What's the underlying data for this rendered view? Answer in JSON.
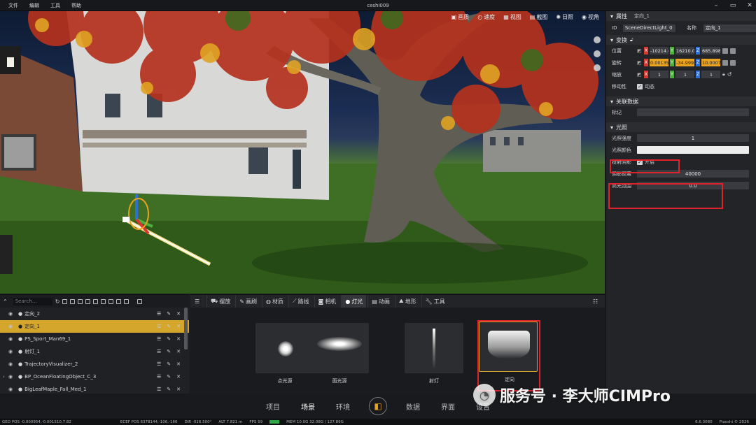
{
  "window": {
    "menu": [
      "文件",
      "编辑",
      "工具",
      "帮助"
    ],
    "title": "ceshi009"
  },
  "viewport": {
    "toolbar": [
      {
        "icon": "image-icon",
        "label": "画质"
      },
      {
        "icon": "speed-icon",
        "label": "速度"
      },
      {
        "icon": "view-icon",
        "label": "视图"
      },
      {
        "icon": "screenshot-icon",
        "label": "截图"
      },
      {
        "icon": "sun-icon",
        "label": "日照"
      },
      {
        "icon": "eye-icon",
        "label": "视角"
      }
    ]
  },
  "properties": {
    "header": {
      "label": "属性",
      "object_name": "定向_1"
    },
    "id_label": "ID",
    "id_value": "SceneDirectLight_0",
    "name_label": "名称",
    "name_value": "定向_1",
    "transform": {
      "title": "变换",
      "position": {
        "label": "位置",
        "x": "-10214.0€",
        "y": "16210.00",
        "z": "685.8981"
      },
      "rotation": {
        "label": "旋转",
        "x": "0.001350",
        "y": "-34.99911",
        "z": "10.000774"
      },
      "scale": {
        "label": "缩放",
        "x": "1",
        "y": "1",
        "z": "1"
      },
      "mobility": {
        "label": "移动性",
        "value": "动态"
      }
    },
    "related": {
      "title": "关联数据",
      "tag_label": "标记",
      "tag_value": ""
    },
    "light": {
      "title": "光照",
      "intensity": {
        "label": "光照强度",
        "value": "1"
      },
      "color": {
        "label": "光照颜色",
        "value": "#ececec"
      },
      "cast_shadow": {
        "label": "投射阴影",
        "value": "开启"
      },
      "shadow_distance": {
        "label": "阴影距离",
        "value": "40000"
      },
      "highlight_range": {
        "label": "高光范围",
        "value": "0.0"
      }
    }
  },
  "outliner": {
    "search_placeholder": "Search...",
    "items": [
      {
        "name": "定向_2",
        "selected": false,
        "expandable": false
      },
      {
        "name": "定向_1",
        "selected": true,
        "expandable": false
      },
      {
        "name": "PS_Sport_Man69_1",
        "selected": false,
        "expandable": false
      },
      {
        "name": "射灯_1",
        "selected": false,
        "expandable": false
      },
      {
        "name": "TrajectoryVisualizer_2",
        "selected": false,
        "expandable": false
      },
      {
        "name": "BP_OceanFloatingObject_C_3",
        "selected": false,
        "expandable": true
      },
      {
        "name": "BigLeafMaple_Fall_Med_1",
        "selected": false,
        "expandable": false
      }
    ]
  },
  "assets": {
    "tabs": [
      "摆放",
      "画刷",
      "材质",
      "路线",
      "相机",
      "灯光",
      "动画",
      "地形",
      "工具"
    ],
    "active_tab": "灯光",
    "cards": [
      "点光源",
      "面光源",
      "射灯",
      "定向"
    ],
    "selected_card": "定向"
  },
  "bottom_nav": {
    "items": [
      "项目",
      "场景",
      "环境",
      "数据",
      "界面",
      "设置"
    ],
    "active": "场景"
  },
  "status": {
    "geo_pos": "GEO POS -0.000954,-0.001510,7.82",
    "ecef_pos": "ECEF POS 6378144,-106,-166",
    "dir": "DIR -016.500°",
    "alt": "ALT 7.821 m",
    "fps": "FPS 59",
    "mem": "MEM 10.0G 32.08G / 127.89G",
    "version": "6.6.3080",
    "copyright": "Piaoshi © 2026"
  },
  "watermark": "服务号 · 李大师CIMPro",
  "colors": {
    "accent": "#d4a62c",
    "highlight_box": "#e0222a",
    "axis_x": "#d8362f",
    "axis_y": "#4caf3d",
    "axis_z": "#2f6fd8",
    "rot_axis": "#e8a21f"
  }
}
